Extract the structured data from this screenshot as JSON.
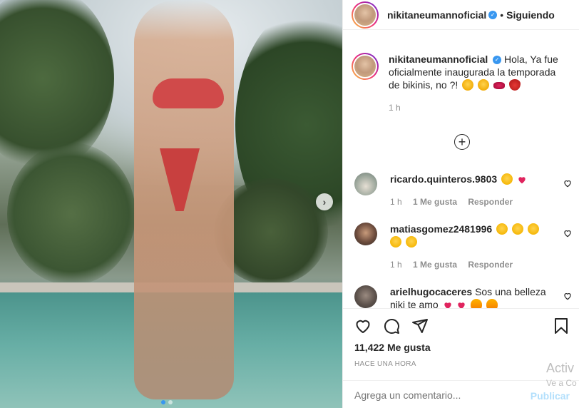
{
  "post": {
    "username": "nikitaneumannoficial",
    "follow_separator": "•",
    "follow_state": "Siguiendo",
    "next_arrow": "›"
  },
  "caption": {
    "username": "nikitaneumannoficial",
    "text": "Hola, Ya fue oficialmente inaugurada la temporada de bikinis, no ?!",
    "time": "1 h",
    "emoji_names": [
      "face-icon",
      "face-icon",
      "lips-icon",
      "strawberry-icon"
    ]
  },
  "load_more_symbol": "+",
  "comments": [
    {
      "username": "ricardo.quinteros.9803",
      "text": "",
      "emoji_names": [
        "heart-eyes-emoji",
        "heart-emoji"
      ],
      "time": "1 h",
      "likes": "1 Me gusta",
      "reply": "Responder"
    },
    {
      "username": "matiasgomez2481996",
      "text": "",
      "emoji_names": [
        "heart-eyes-emoji",
        "heart-eyes-emoji",
        "heart-eyes-emoji",
        "heart-eyes-emoji",
        "heart-eyes-emoji"
      ],
      "time": "1 h",
      "likes": "1 Me gusta",
      "reply": "Responder"
    },
    {
      "username": "arielhugocaceres",
      "text": "Sos una belleza niki te amo"
    }
  ],
  "actions": {
    "likes_count": "11,422 Me gusta",
    "time_ago": "HACE UNA HORA",
    "comment_placeholder": "Agrega un comentario...",
    "publish_label": "Publicar"
  },
  "os_overlay": {
    "line1": "Activ",
    "line2": "Ve a Co"
  },
  "colors": {
    "link_blue": "#3897f0",
    "publish_disabled": "#b2dffc",
    "heart_red": "#ed4956"
  }
}
